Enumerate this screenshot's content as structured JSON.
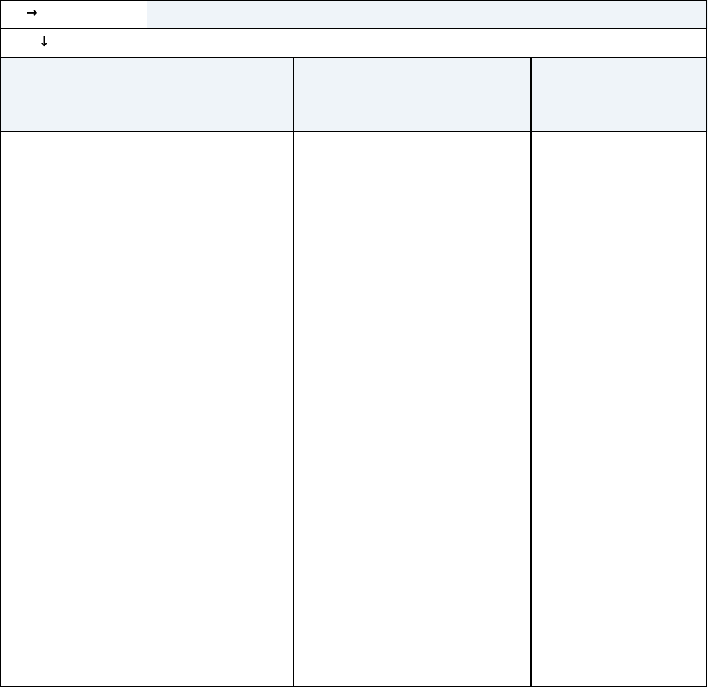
{
  "toolbar": {
    "expand_icon": "arrow-right-icon",
    "sort_icon": "arrow-down-icon",
    "expand_glyph": "→",
    "sort_glyph": "↓"
  },
  "colors": {
    "header_fill": "#eff4f9",
    "border": "#000000"
  },
  "table": {
    "columns": [
      "",
      "",
      ""
    ],
    "rows": []
  }
}
